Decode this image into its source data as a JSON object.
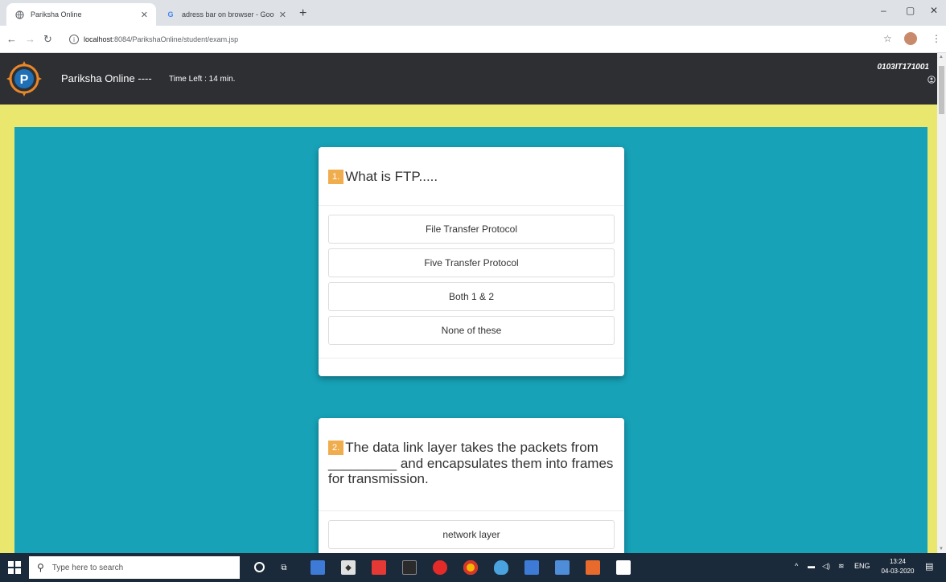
{
  "browser": {
    "tabs": [
      {
        "title": "Pariksha Online",
        "active": true
      },
      {
        "title": "adress bar on browser - Google",
        "active": false
      }
    ],
    "new_tab": "+",
    "url_host": "localhost",
    "url_rest": ":8084/ParikshaOnline/student/exam.jsp",
    "window_controls": {
      "minimize": "–",
      "maximize": "▢",
      "close": "✕"
    }
  },
  "app": {
    "brand": "Pariksha Online ----",
    "timer": "Time Left : 14 min.",
    "user_id": "0103IT171001"
  },
  "questions": [
    {
      "number": "1.",
      "text": "What is FTP.....",
      "options": [
        "File Transfer Protocol",
        "Five Transfer Protocol",
        "Both 1 & 2",
        "None of these"
      ]
    },
    {
      "number": "2.",
      "text": "The data link layer takes the packets from _________ and encapsulates them into frames for transmission.",
      "options": [
        "network layer"
      ]
    }
  ],
  "taskbar": {
    "search_placeholder": "Type here to search",
    "tray_language": "ENG",
    "time": "13:24",
    "date": "04-03-2020"
  },
  "colors": {
    "header_bg": "#2d2f33",
    "page_bg": "#e9e76e",
    "panel_bg": "#17a2b8",
    "question_badge": "#f0ad4e"
  }
}
